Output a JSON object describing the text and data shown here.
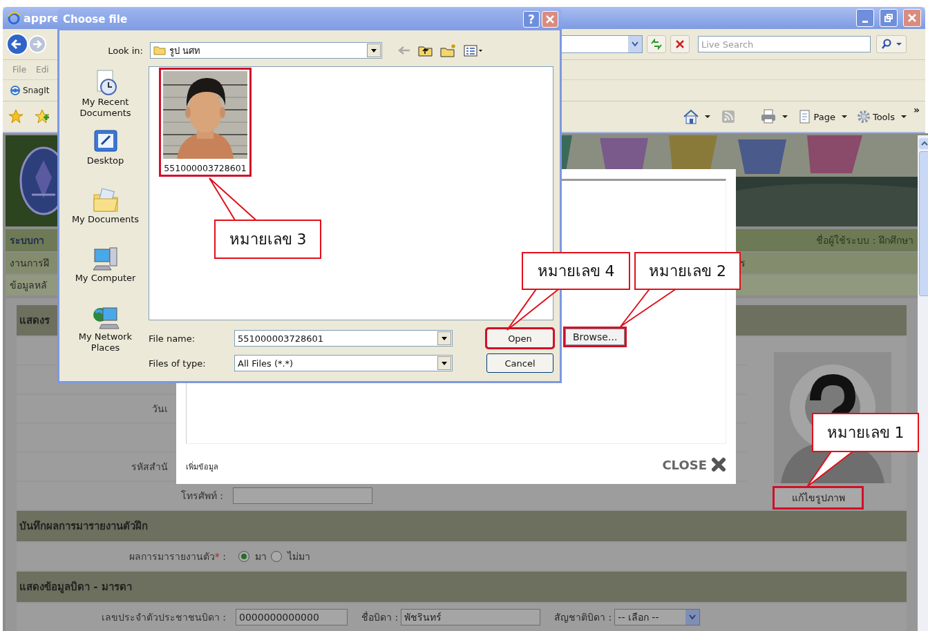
{
  "browser": {
    "title": "appre",
    "menu": [
      "File",
      "Edi"
    ],
    "links": [
      "SnagIt"
    ],
    "search": {
      "placeholder": "Live Search"
    },
    "commands": [
      {
        "label": "Page"
      },
      {
        "label": "Tools"
      }
    ],
    "more": "»"
  },
  "page": {
    "header": {
      "title": "ระบบกา",
      "user": "ชื่อผู้ใช้ระบบ : ฝึกศึกษา"
    },
    "menu_rows": [
      [
        "งานการฝึ",
        "ร"
      ],
      [
        "ข้อมูลหลั"
      ]
    ],
    "profile": {
      "title": "แสดงร",
      "rows": [
        {
          "label": "วันเ",
          "kind": "label"
        },
        {
          "label": "รหัสสำนั",
          "kind": "label"
        },
        {
          "label": "โทรศัพท์ :",
          "kind": "input"
        }
      ],
      "photo_button": {
        "label": "แก้ไขรูปภาพ",
        "highlighted": true
      }
    },
    "report": {
      "title": "บันทึกผลการมารายงานตัวฝึก",
      "label": "ผลการมารายงานตัว",
      "required": "*",
      "suffix": " :",
      "options": [
        {
          "label": "มา",
          "selected": true
        },
        {
          "label": "ไม่มา",
          "selected": false
        }
      ]
    },
    "parents": {
      "title": "แสดงข้อมูลบิดา - มารดา",
      "fields": [
        {
          "label": "เลขประจำตัวประชาชนบิดา :",
          "value": "0000000000000",
          "kind": "input"
        },
        {
          "label": "ชื่อบิดา :",
          "value": "พัชรินทร์",
          "kind": "input"
        },
        {
          "label": "สัญชาติบิดา :",
          "value": "-- เลือก --",
          "kind": "select"
        }
      ]
    }
  },
  "modal": {
    "browse": {
      "label": "Browse...",
      "highlighted": true
    },
    "link": "เพิ่มข้อมูล",
    "close": "CLOSE"
  },
  "dialog": {
    "title": "Choose file",
    "help": "?",
    "look_in_label": "Look in:",
    "look_in": "รูป นศท",
    "places": [
      {
        "label": "My Recent Documents",
        "kind": "recent"
      },
      {
        "label": "Desktop",
        "kind": "desktop"
      },
      {
        "label": "My Documents",
        "kind": "documents"
      },
      {
        "label": "My Computer",
        "kind": "computer"
      },
      {
        "label": "My Network Places",
        "kind": "network"
      }
    ],
    "files": [
      {
        "name": "551000003728601",
        "kind": "picture",
        "highlighted": true
      }
    ],
    "file_name_label": "File name:",
    "file_name": "551000003728601",
    "type_label": "Files of type:",
    "file_type": "All Files (*.*)",
    "buttons": [
      {
        "label": "Open",
        "highlighted": true
      },
      {
        "label": "Cancel",
        "highlighted": false
      }
    ]
  },
  "callouts": [
    {
      "text": "หมายเลข 3"
    },
    {
      "text": "หมายเลข 4"
    },
    {
      "text": "หมายเลข 2"
    },
    {
      "text": "หมายเลข 1"
    }
  ]
}
